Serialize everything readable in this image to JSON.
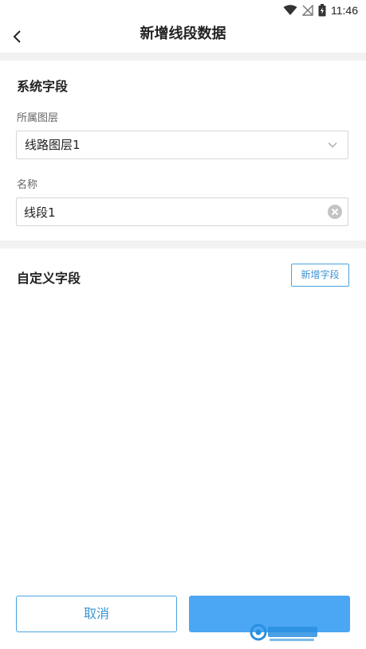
{
  "status_bar": {
    "time": "11:46"
  },
  "header": {
    "title": "新增线段数据"
  },
  "system_fields": {
    "section_title": "系统字段",
    "layer_label": "所属图层",
    "layer_value": "线路图层1",
    "name_label": "名称",
    "name_value": "线段1"
  },
  "custom_fields": {
    "section_title": "自定义字段",
    "add_button_label": "新增字段"
  },
  "footer": {
    "cancel_label": "取消",
    "confirm_label": ""
  },
  "colors": {
    "accent": "#4aa3df",
    "primary_button": "#4ba6f3",
    "divider": "#f2f2f2"
  },
  "icons": {
    "back": "chevron-left-icon",
    "dropdown": "chevron-down-icon",
    "clear": "clear-circle-icon",
    "wifi": "wifi-icon",
    "signal": "no-signal-icon",
    "battery": "battery-charging-icon"
  }
}
